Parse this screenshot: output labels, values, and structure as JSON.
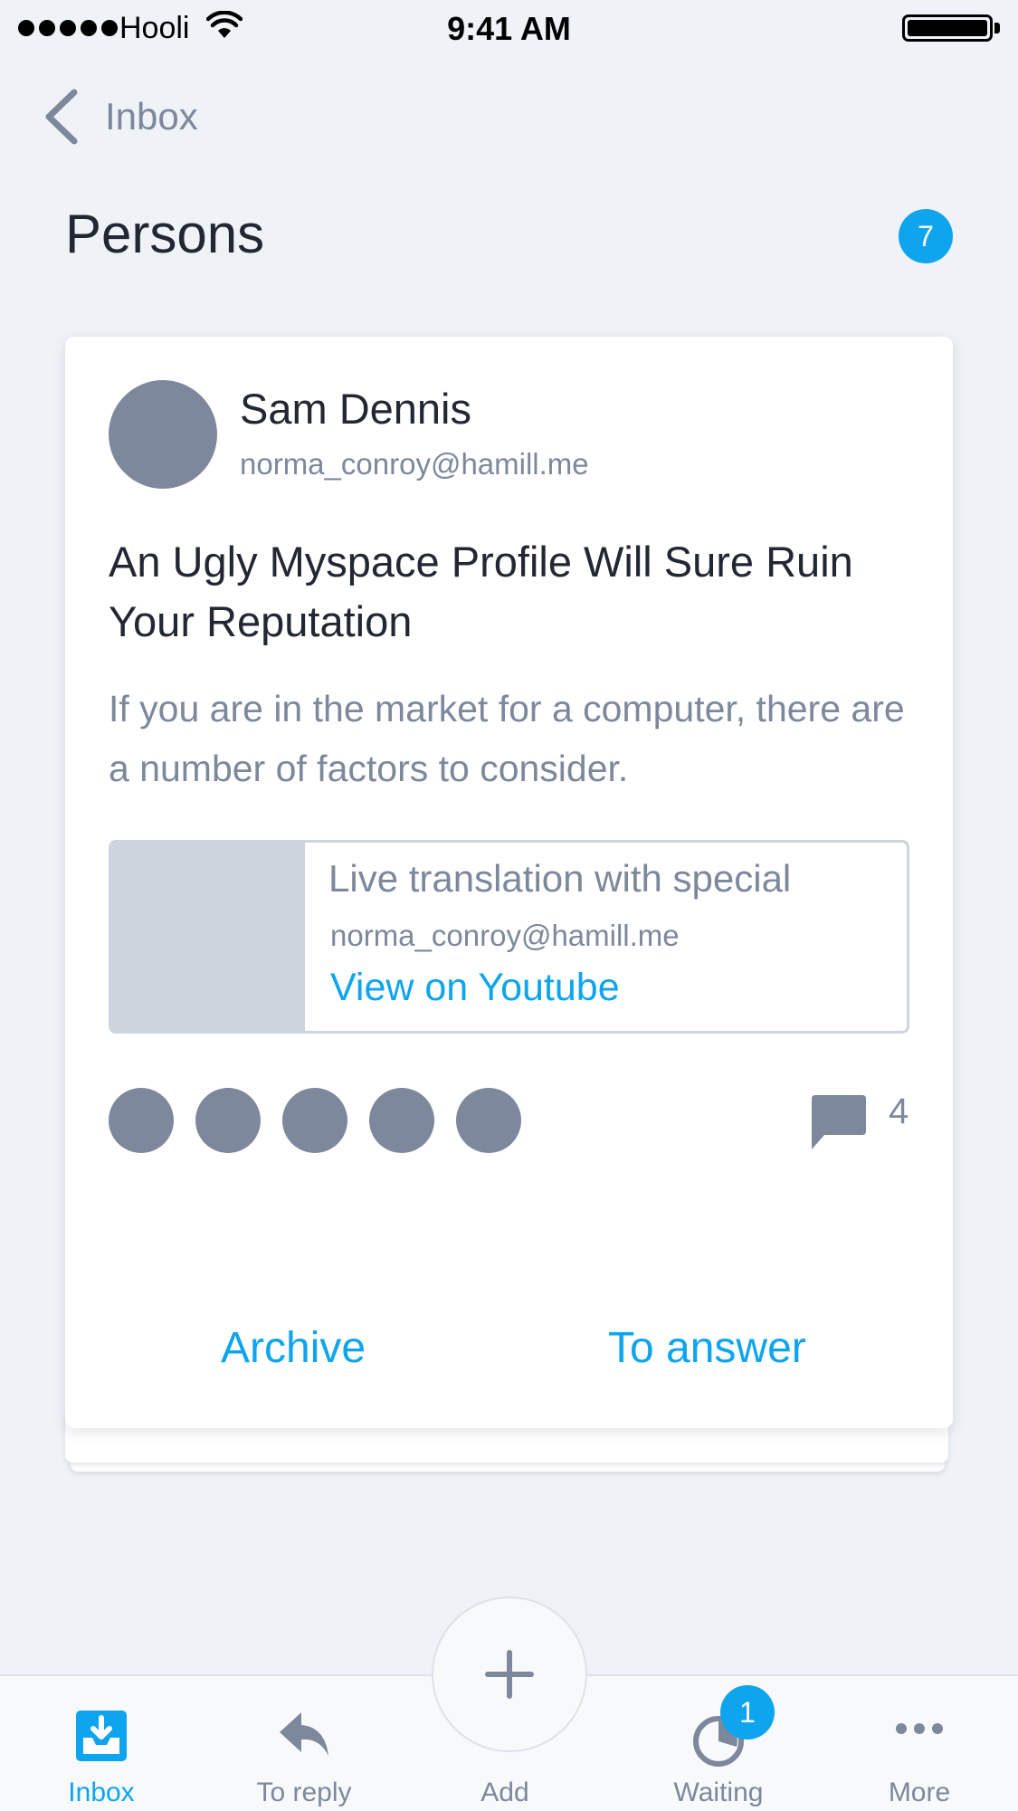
{
  "status_bar": {
    "carrier": "Hooli",
    "time": "9:41 AM"
  },
  "nav": {
    "back_label": "Inbox"
  },
  "page": {
    "title": "Persons",
    "count": "7"
  },
  "card": {
    "sender_name": "Sam Dennis",
    "sender_email": "norma_conroy@hamill.me",
    "subject": "An Ugly Myspace Profile Will Sure Ruin Your Reputation",
    "preview": "If you are in the market for a computer, there are a number of factors to consider.",
    "attachment": {
      "title": "Live translation with special",
      "email": "norma_conroy@hamill.me",
      "link_label": "View on Youtube"
    },
    "participants_count": 5,
    "comment_count": "4",
    "actions": {
      "archive": "Archive",
      "answer": "To answer"
    }
  },
  "tab_bar": {
    "tabs": [
      {
        "label": "Inbox",
        "icon": "inbox-icon",
        "active": true
      },
      {
        "label": "To reply",
        "icon": "reply-icon"
      },
      {
        "label": "Add",
        "icon": "plus-icon"
      },
      {
        "label": "Waiting",
        "icon": "waiting-icon",
        "badge": "1"
      },
      {
        "label": "More",
        "icon": "more-icon"
      }
    ]
  },
  "colors": {
    "accent": "#0ea5ee",
    "muted": "#7d889c",
    "background": "#eff2f7"
  }
}
